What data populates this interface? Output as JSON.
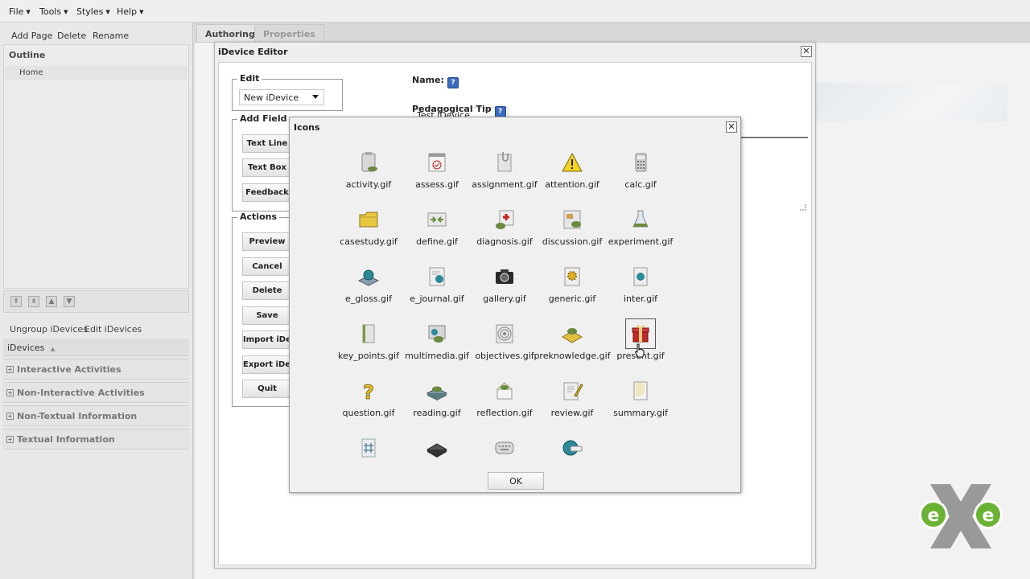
{
  "menu": [
    {
      "label": "File"
    },
    {
      "label": "Tools"
    },
    {
      "label": "Styles"
    },
    {
      "label": "Help"
    }
  ],
  "left_panel": {
    "add_page": "Add Page",
    "delete": "Delete",
    "rename": "Rename",
    "outline_title": "Outline",
    "outline_items": [
      "Home"
    ],
    "ungroup": "Ungroup iDevices",
    "edit_idevices": "Edit iDevices",
    "idevices_header": "iDevices",
    "categories": [
      "Interactive Activities",
      "Non-Interactive Activities",
      "Non-Textual Information",
      "Textual Information"
    ]
  },
  "tabs": [
    {
      "label": "Authoring"
    },
    {
      "label": "Properties"
    }
  ],
  "editor": {
    "title": "iDevice Editor",
    "edit_legend": "Edit",
    "edit_select_value": "New iDevice",
    "add_field_legend": "Add Field",
    "add_field_buttons": [
      "Text Line",
      "Text Box",
      "Feedback"
    ],
    "actions_legend": "Actions",
    "action_buttons": [
      "Preview",
      "Cancel",
      "Delete",
      "Save",
      "Import iDevice",
      "Export iDevice",
      "Quit"
    ],
    "name_label": "Name:",
    "name_value": "Test iDevice",
    "pedagogical_label": "Pedagogical Tip",
    "help_glyph": "?"
  },
  "icons_dialog": {
    "title": "Icons",
    "ok_label": "OK",
    "icons": [
      {
        "label": "activity.gif",
        "icon": "clipboard-icon"
      },
      {
        "label": "assess.gif",
        "icon": "calendar-check-icon"
      },
      {
        "label": "assignment.gif",
        "icon": "clipboard-clip-icon"
      },
      {
        "label": "attention.gif",
        "icon": "warning-icon"
      },
      {
        "label": "calc.gif",
        "icon": "calculator-icon"
      },
      {
        "label": "casestudy.gif",
        "icon": "folder-icon"
      },
      {
        "label": "define.gif",
        "icon": "define-arrows-icon"
      },
      {
        "label": "diagnosis.gif",
        "icon": "medical-icon"
      },
      {
        "label": "discussion.gif",
        "icon": "discussion-icon"
      },
      {
        "label": "experiment.gif",
        "icon": "flask-icon"
      },
      {
        "label": "e_gloss.gif",
        "icon": "globe-book-icon"
      },
      {
        "label": "e_journal.gif",
        "icon": "journal-icon"
      },
      {
        "label": "gallery.gif",
        "icon": "camera-icon"
      },
      {
        "label": "generic.gif",
        "icon": "gear-doc-icon"
      },
      {
        "label": "inter.gif",
        "icon": "interactive-doc-icon"
      },
      {
        "label": "key_points.gif",
        "icon": "key-points-icon"
      },
      {
        "label": "multimedia.gif",
        "icon": "multimedia-icon"
      },
      {
        "label": "objectives.gif",
        "icon": "target-icon"
      },
      {
        "label": "preknowledge.gif",
        "icon": "preknowledge-icon"
      },
      {
        "label": "present.gif",
        "icon": "gift-icon"
      },
      {
        "label": "question.gif",
        "icon": "question-icon"
      },
      {
        "label": "reading.gif",
        "icon": "book-icon"
      },
      {
        "label": "reflection.gif",
        "icon": "reflection-icon"
      },
      {
        "label": "review.gif",
        "icon": "pencil-doc-icon"
      },
      {
        "label": "summary.gif",
        "icon": "summary-icon"
      },
      {
        "label": "",
        "icon": "hash-doc-icon"
      },
      {
        "label": "",
        "icon": "chip-icon"
      },
      {
        "label": "",
        "icon": "keyboard-icon"
      },
      {
        "label": "",
        "icon": "www-globe-icon"
      }
    ],
    "selected_icon": "present.gif"
  },
  "logo": {
    "letters": "e",
    "colors": {
      "green": "#6ab233",
      "gray": "#8a8a8a"
    }
  }
}
